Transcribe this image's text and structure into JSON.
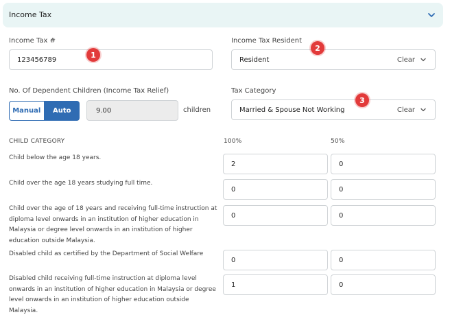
{
  "section": {
    "title": "Income Tax",
    "toggle_icon": "chevron-down-icon"
  },
  "income_tax_no": {
    "label": "Income Tax #",
    "value": "123456789"
  },
  "tax_resident": {
    "label": "Income Tax Resident",
    "value": "Resident",
    "clear_label": "Clear"
  },
  "dependents": {
    "label": "No. Of Dependent Children (Income Tax Relief)",
    "manual_label": "Manual",
    "auto_label": "Auto",
    "selected_mode": "Auto",
    "value": "9.00",
    "unit": "children"
  },
  "tax_category": {
    "label": "Tax Category",
    "value": "Married & Spouse Not Working",
    "clear_label": "Clear"
  },
  "annotations": [
    "1",
    "2",
    "3"
  ],
  "child_table": {
    "header": "CHILD CATEGORY",
    "col_100": "100%",
    "col_50": "50%",
    "rows": [
      {
        "label": "Child below the age 18 years.",
        "full": "2",
        "half": "0"
      },
      {
        "label": "Child over the age 18 years studying full time.",
        "full": "0",
        "half": "0"
      },
      {
        "label": "Child over the age of 18 years and receiving full-time instruction at diploma level onwards in an institution of higher education in Malaysia or degree level onwards in an institution of higher education outside Malaysia.",
        "full": "0",
        "half": "0"
      },
      {
        "label": "Disabled child as certified by the Department of Social Welfare",
        "full": "0",
        "half": "0"
      },
      {
        "label": "Disabled child receiving full-time instruction at diploma level onwards in an institution of higher education in Malaysia or degree level onwards in an institution of higher education outside Malaysia.",
        "full": "1",
        "half": "0"
      }
    ]
  },
  "colors": {
    "accent": "#2f6cb3",
    "header_bg": "#e9f5f5",
    "badge": "#e23a3a"
  }
}
